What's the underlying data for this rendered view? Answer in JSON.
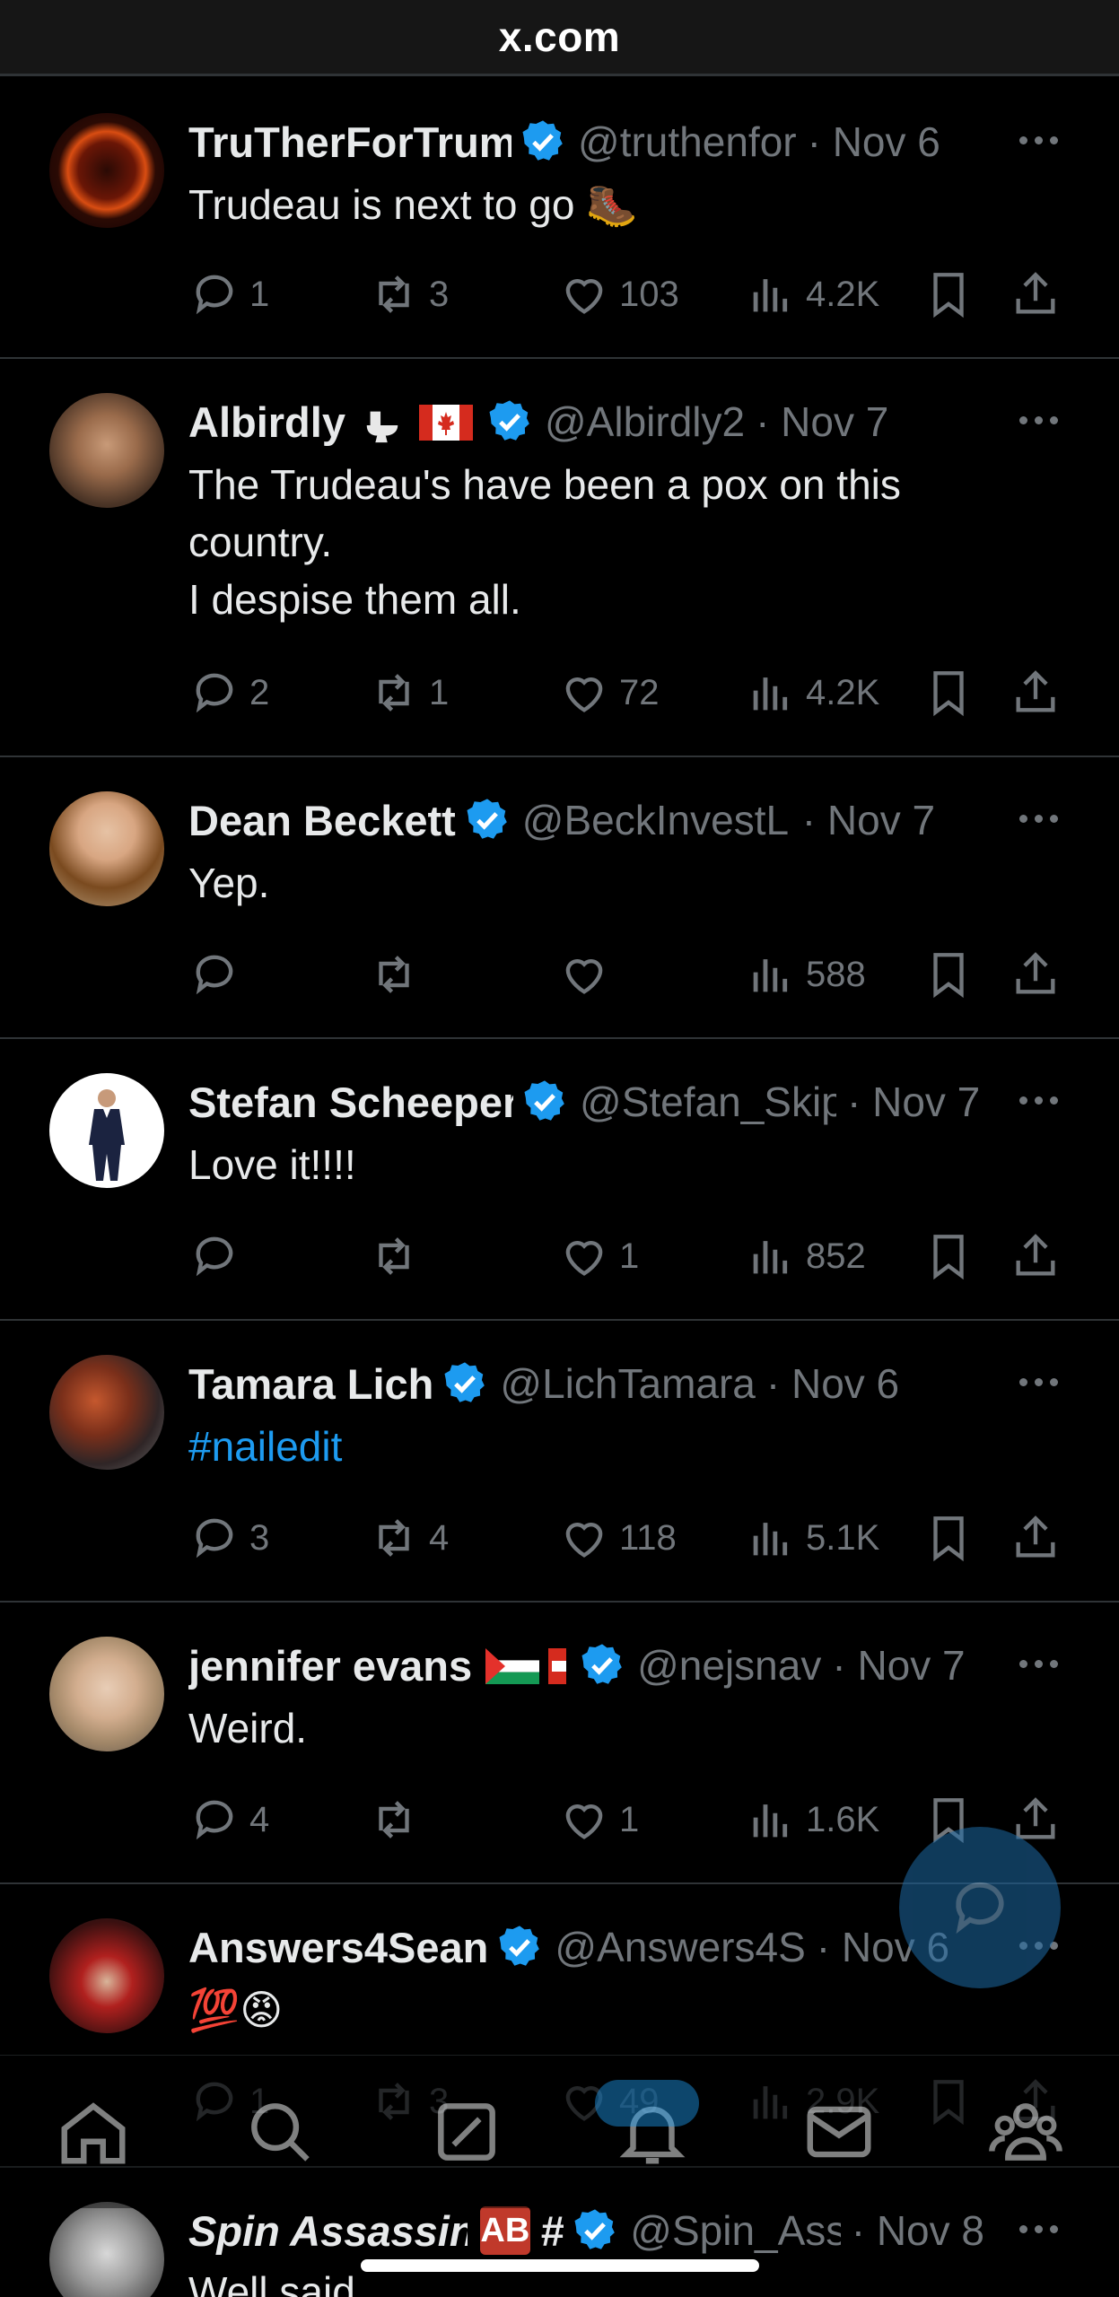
{
  "url_bar": {
    "host": "x.com"
  },
  "tweets": [
    {
      "name": "TruTherForTrum",
      "handle": "@truthenfor",
      "date": "· Nov 6",
      "text": "Trudeau is next to go 🥾",
      "replies": "1",
      "reposts": "3",
      "likes": "103",
      "views": "4.2K"
    },
    {
      "name": "Albirdly",
      "handle": "@Albirdly2",
      "date": "· Nov 7",
      "text_lines": [
        "The Trudeau's have been a pox on this",
        "country.",
        "I despise them all."
      ],
      "replies": "2",
      "reposts": "1",
      "likes": "72",
      "views": "4.2K"
    },
    {
      "name": "Dean Beckett",
      "handle": "@BeckInvestLI",
      "date": "· Nov 7",
      "text": "Yep.",
      "replies": "",
      "reposts": "",
      "likes": "",
      "views": "588"
    },
    {
      "name": "Stefan Scheepers",
      "handle": "@Stefan_Skip",
      "date": "· Nov 7",
      "text": "Love it!!!!",
      "replies": "",
      "reposts": "",
      "likes": "1",
      "views": "852"
    },
    {
      "name": "Tamara Lich",
      "handle": "@LichTamara",
      "date": "· Nov 6",
      "text": "#nailedit",
      "replies": "3",
      "reposts": "4",
      "likes": "118",
      "views": "5.1K"
    },
    {
      "name": "jennifer evans",
      "handle": "@nejsnav",
      "date": "· Nov 7",
      "text": "Weird.",
      "replies": "4",
      "reposts": "",
      "likes": "1",
      "views": "1.6K"
    },
    {
      "name": "Answers4Sean",
      "handle": "@Answers4S",
      "date": "· Nov 6",
      "text": "💯😡",
      "replies": "1",
      "reposts": "3",
      "likes": "49",
      "views": "2.9K"
    },
    {
      "name": "Spin Assassin",
      "handle": "@Spin_Ass",
      "date": "· Nov 8",
      "text": "Well said"
    }
  ],
  "colors": {
    "background": "#000000",
    "accent": "#1d9bf0",
    "muted": "#71767b",
    "text": "#e7e9ea",
    "divider": "#2f3336"
  },
  "tabbar": {
    "items": [
      "home-icon",
      "search-icon",
      "grok-icon",
      "notifications-icon",
      "messages-icon",
      "communities-icon"
    ]
  },
  "fab": {
    "icon": "reply-bubble-icon"
  }
}
